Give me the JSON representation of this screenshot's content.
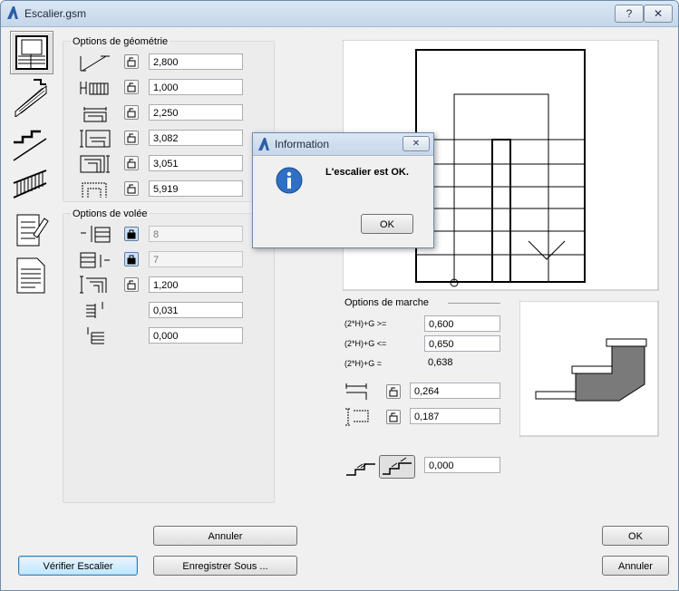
{
  "window": {
    "title": "Escalier.gsm",
    "help_label": "?",
    "close_label": "✕"
  },
  "geometry": {
    "title": "Options de géométrie",
    "fields": [
      "2,800",
      "1,000",
      "2,250",
      "3,082",
      "3,051",
      "5,919"
    ]
  },
  "flight": {
    "title": "Options de volée",
    "fields": [
      "8",
      "7",
      "1,200",
      "0,031",
      "0,000"
    ]
  },
  "step": {
    "title": "Options de marche",
    "rule1": "(2*H)+G >=",
    "rule1_value": "0,600",
    "rule2": "(2*H)+G <=",
    "rule2_value": "0,650",
    "rule3": "(2*H)+G =",
    "rule3_value": "0,638",
    "tread": "0,264",
    "riser": "0,187",
    "nosing": "0,000"
  },
  "buttons": {
    "cancel": "Annuler",
    "check": "Vérifier Escalier",
    "save_as": "Enregistrer Sous ...",
    "ok": "OK",
    "cancel_right": "Annuler"
  },
  "dialog": {
    "title": "Information",
    "message": "L'escalier est OK.",
    "ok": "OK",
    "close": "✕"
  },
  "icons": [
    "stair-plan-icon",
    "stair-slope-icon",
    "stair-section-icon",
    "railing-icon",
    "edit-icon",
    "document-icon",
    "lock-icon",
    "info-icon"
  ]
}
